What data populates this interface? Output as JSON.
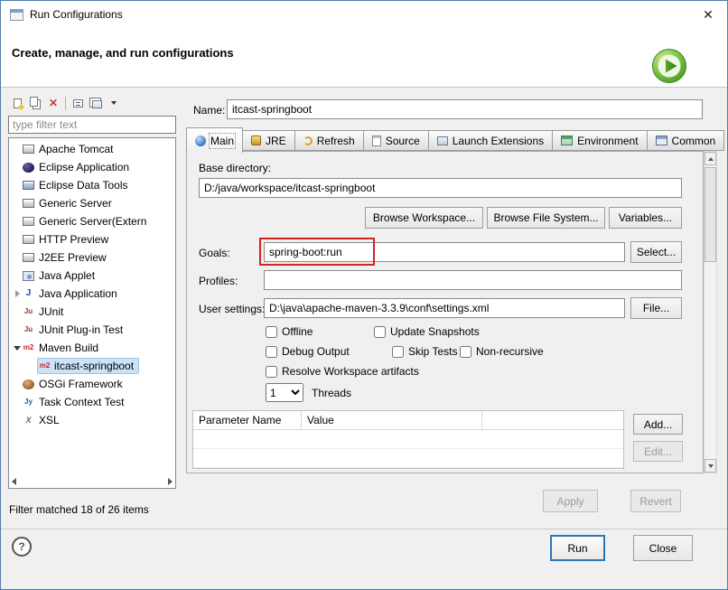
{
  "window": {
    "title": "Run Configurations",
    "close_glyph": "✕"
  },
  "header": {
    "title": "Create, manage, and run configurations"
  },
  "icon_glyphs": {
    "java": "J",
    "junit": "Ju",
    "maven": "m2",
    "task": "Jy",
    "xsl": "X",
    "delete": "✕"
  },
  "colors": {
    "selection_blue": "#cbe3f7",
    "annotation_red": "#d22222",
    "run_focus_border": "#2e75b6",
    "badge_green": "#3f8f1f"
  },
  "sidebar": {
    "filter": {
      "placeholder": "type filter text"
    },
    "tree": [
      {
        "label": "Apache Tomcat",
        "icon": "server-icon"
      },
      {
        "label": "Eclipse Application",
        "icon": "eclipse-icon"
      },
      {
        "label": "Eclipse Data Tools",
        "icon": "data-tools-icon"
      },
      {
        "label": "Generic Server",
        "icon": "server-icon"
      },
      {
        "label": "Generic Server(Extern",
        "icon": "server-icon"
      },
      {
        "label": "HTTP Preview",
        "icon": "server-icon"
      },
      {
        "label": "J2EE Preview",
        "icon": "server-icon"
      },
      {
        "label": "Java Applet",
        "icon": "applet-icon"
      },
      {
        "label": "Java Application",
        "icon": "java-application-icon",
        "expander": "collapsed"
      },
      {
        "label": "JUnit",
        "icon": "junit-icon"
      },
      {
        "label": "JUnit Plug-in Test",
        "icon": "junit-plugin-icon"
      },
      {
        "label": "Maven Build",
        "icon": "maven-icon",
        "expander": "expanded"
      },
      {
        "label": "itcast-springboot",
        "icon": "maven-icon",
        "selected": true,
        "child": true
      },
      {
        "label": "OSGi Framework",
        "icon": "osgi-icon"
      },
      {
        "label": "Task Context Test",
        "icon": "task-icon"
      },
      {
        "label": "XSL",
        "icon": "xsl-icon"
      }
    ],
    "status": "Filter matched 18 of 26 items"
  },
  "form": {
    "name_label": "Name:",
    "name_value": "itcast-springboot",
    "tabs": [
      {
        "label": "Main",
        "icon": "main-tab-icon",
        "active": true
      },
      {
        "label": "JRE",
        "icon": "jre-tab-icon"
      },
      {
        "label": "Refresh",
        "icon": "refresh-tab-icon"
      },
      {
        "label": "Source",
        "icon": "source-tab-icon"
      },
      {
        "label": "Launch Extensions",
        "icon": "launch-extensions-tab-icon"
      },
      {
        "label": "Environment",
        "icon": "environment-tab-icon"
      },
      {
        "label": "Common",
        "icon": "common-tab-icon"
      }
    ],
    "base_directory": {
      "label": "Base directory:",
      "value": "D:/java/workspace/itcast-springboot"
    },
    "goals": {
      "label": "Goals:",
      "value": "spring-boot:run"
    },
    "profiles": {
      "label": "Profiles:",
      "value": ""
    },
    "user_settings": {
      "label": "User settings:",
      "value": "D:\\java\\apache-maven-3.3.9\\conf\\settings.xml"
    },
    "buttons": {
      "browse_workspace": "Browse Workspace...",
      "browse_file_system": "Browse File System...",
      "variables": "Variables...",
      "select": "Select...",
      "file": "File...",
      "add": "Add...",
      "edit": "Edit...",
      "apply": "Apply",
      "revert": "Revert"
    },
    "checkboxes": {
      "offline": "Offline",
      "update_snapshots": "Update Snapshots",
      "debug_output": "Debug Output",
      "skip_tests": "Skip Tests",
      "non_recursive": "Non-recursive",
      "resolve_workspace": "Resolve Workspace artifacts"
    },
    "threads": {
      "value": "1",
      "label": "Threads"
    },
    "param_table": {
      "columns": [
        "Parameter Name",
        "Value"
      ]
    }
  },
  "footer": {
    "help_glyph": "?",
    "run": "Run",
    "close": "Close"
  }
}
